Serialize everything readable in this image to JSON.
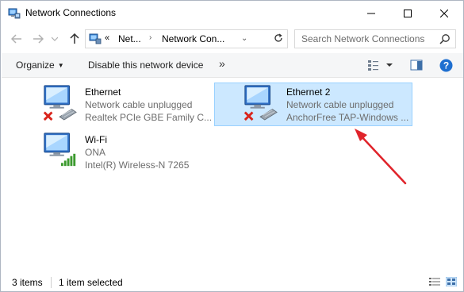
{
  "window": {
    "title": "Network Connections",
    "controls": {
      "minimize": "minimize",
      "maximize": "maximize",
      "close": "close"
    }
  },
  "address": {
    "overflow": "«",
    "crumbs": [
      "Net...",
      "Network Con..."
    ],
    "search_placeholder": "Search Network Connections"
  },
  "toolbar": {
    "organize": "Organize",
    "disable": "Disable this network device",
    "more": "»"
  },
  "items": [
    {
      "name": "Ethernet",
      "status": "Network cable unplugged",
      "device": "Realtek PCIe GBE Family C...",
      "selected": false,
      "state": "disconnected"
    },
    {
      "name": "Ethernet 2",
      "status": "Network cable unplugged",
      "device": "AnchorFree TAP-Windows ...",
      "selected": true,
      "state": "disconnected"
    },
    {
      "name": "Wi-Fi",
      "status": "ONA",
      "device": "Intel(R) Wireless-N 7265",
      "selected": false,
      "state": "wifi"
    }
  ],
  "statusbar": {
    "count": "3 items",
    "selection": "1 item selected"
  },
  "colors": {
    "selection_bg": "#cce8ff",
    "selection_border": "#99d1ff",
    "arrow": "#e0242b",
    "error_x": "#d9241c",
    "signal": "#3c9a2e"
  }
}
